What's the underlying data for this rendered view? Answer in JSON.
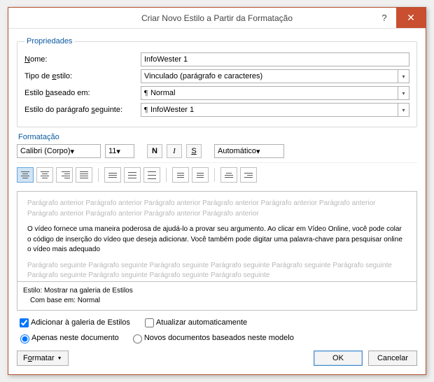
{
  "titlebar": {
    "title": "Criar Novo Estilo a Partir da Formatação",
    "help": "?",
    "close": "✕"
  },
  "props": {
    "legend": "Propriedades",
    "name_label": "Nome:",
    "name_value": "InfoWester 1",
    "type_label": "Tipo de estilo:",
    "type_value": "Vinculado (parágrafo e caracteres)",
    "based_label": "Estilo baseado em:",
    "based_value": "Normal",
    "next_label": "Estilo do parágrafo seguinte:",
    "next_value": "InfoWester 1"
  },
  "fmt": {
    "legend": "Formatação",
    "font_name": "Calibri (Corpo)",
    "font_size": "11",
    "bold": "N",
    "italic": "I",
    "underline": "S",
    "color": "Automático"
  },
  "preview": {
    "before": "Parágrafo anterior Parágrafo anterior Parágrafo anterior Parágrafo anterior Parágrafo anterior Parágrafo anterior Parágrafo anterior Parágrafo anterior Parágrafo anterior Parágrafo anterior",
    "main": "O vídeo fornece uma maneira poderosa de ajudá-lo a provar seu argumento. Ao clicar em Vídeo Online, você pode colar o código de inserção do vídeo que deseja adicionar. Você também pode digitar uma palavra-chave para pesquisar online o vídeo mais adequado",
    "after": "Parágrafo seguinte Parágrafo seguinte Parágrafo seguinte Parágrafo seguinte Parágrafo seguinte Parágrafo seguinte Parágrafo seguinte Parágrafo seguinte Parágrafo seguinte Parágrafo seguinte"
  },
  "summary": {
    "line1": "Estilo: Mostrar na galeria de Estilos",
    "line2": "Com base em: Normal"
  },
  "options": {
    "add_gallery": "Adicionar à galeria de Estilos",
    "auto_update": "Atualizar automaticamente",
    "only_doc": "Apenas neste documento",
    "new_docs": "Novos documentos baseados neste modelo"
  },
  "footer": {
    "format": "Formatar",
    "ok": "OK",
    "cancel": "Cancelar"
  }
}
